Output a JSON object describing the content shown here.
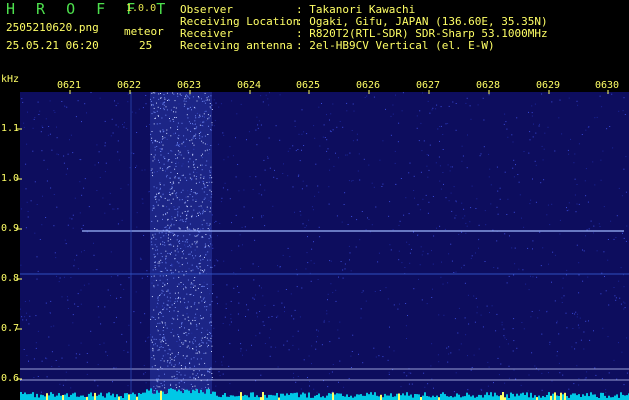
{
  "header": {
    "title": "H R O F F T",
    "version": "1.0.0",
    "filename": "2505210620.png",
    "meteor_label": "meteor",
    "datetime": "25.05.21 06:20",
    "meteor_count": "25",
    "info": [
      {
        "key": "Observer",
        "value": ": Takanori Kawachi"
      },
      {
        "key": "Receiving Location",
        "value": ": Ogaki, Gifu, JAPAN (136.60E, 35.35N)"
      },
      {
        "key": "Receiver",
        "value": ": R820T2(RTL-SDR) SDR-Sharp 53.1000MHz"
      },
      {
        "key": "Receiving antenna",
        "value": ": 2el-HB9CV Vertical (el. E-W)"
      }
    ]
  },
  "axis": {
    "y_unit": "kHz",
    "y_ticks": [
      "1.1",
      "1.0",
      "0.9",
      "0.8",
      "0.7",
      "0.6"
    ],
    "x_ticks": [
      "0621",
      "0622",
      "0623",
      "0624",
      "0625",
      "0626",
      "0627",
      "0628",
      "0629",
      "0630"
    ]
  },
  "colors": {
    "background": "#000000",
    "spectrogram": "#10106a",
    "text": "#ffff66",
    "title": "#4de04d",
    "signal_line": "#a0b8ff",
    "baseline": "#00c8e6"
  }
}
